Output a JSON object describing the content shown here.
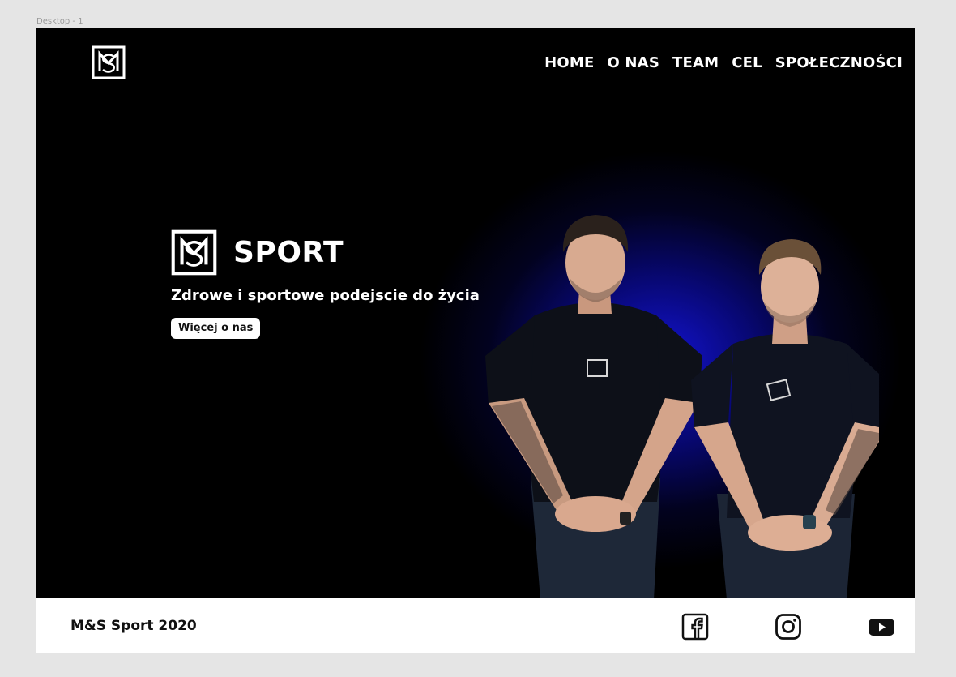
{
  "canvas": {
    "frame_label": "Desktop - 1"
  },
  "nav": {
    "items": [
      {
        "label": "HOME"
      },
      {
        "label": "O NAS"
      },
      {
        "label": "TEAM"
      },
      {
        "label": "CEL"
      },
      {
        "label": "SPOŁECZNOŚCI"
      }
    ]
  },
  "hero": {
    "title": "SPORT",
    "tagline": "Zdrowe i sportowe podejscie do życia",
    "cta_label": "Więcej o nas",
    "logo_icon": "ms-monogram-icon",
    "image": "two-men-black-tshirts-photo"
  },
  "footer": {
    "copyright": "M&S Sport 2020",
    "social": [
      "facebook-icon",
      "instagram-icon",
      "youtube-icon"
    ]
  },
  "colors": {
    "background": "#000000",
    "glow": "#1414dc",
    "text": "#ffffff",
    "footer": "#ffffff",
    "canvas": "#e5e5e5"
  }
}
